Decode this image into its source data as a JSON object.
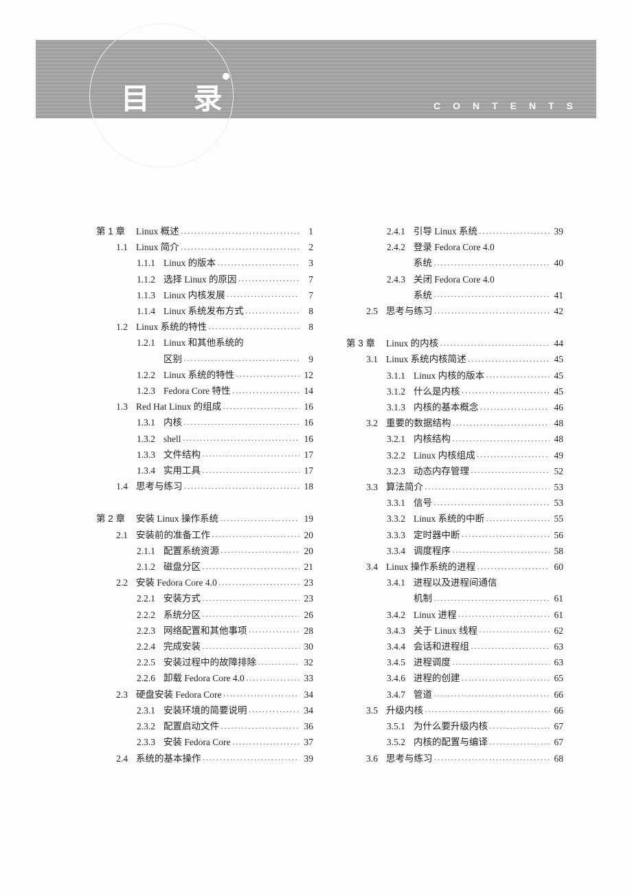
{
  "header": {
    "title_cn": "目 录",
    "title_en": "CONTENTS"
  },
  "columns": [
    [
      {
        "type": "chap",
        "num": "第 1 章",
        "label": "Linux 概述",
        "page": "1"
      },
      {
        "type": "sec",
        "num": "1.1",
        "label": "Linux 简介",
        "page": "2"
      },
      {
        "type": "sub",
        "num": "1.1.1",
        "label": "Linux 的版本",
        "page": "3"
      },
      {
        "type": "sub",
        "num": "1.1.2",
        "label": "选择 Linux 的原因",
        "page": "7"
      },
      {
        "type": "sub",
        "num": "1.1.3",
        "label": "Linux 内核发展",
        "page": "7"
      },
      {
        "type": "sub",
        "num": "1.1.4",
        "label": "Linux 系统发布方式",
        "page": "8"
      },
      {
        "type": "sec",
        "num": "1.2",
        "label": "Linux 系统的特性",
        "page": "8"
      },
      {
        "type": "sub",
        "num": "1.2.1",
        "label": "Linux 和其他系统的",
        "cont": true
      },
      {
        "type": "subcont",
        "label": "区别",
        "page": "9"
      },
      {
        "type": "sub",
        "num": "1.2.2",
        "label": "Linux 系统的特性",
        "page": "12"
      },
      {
        "type": "sub",
        "num": "1.2.3",
        "label": "Fedora Core 特性",
        "page": "14"
      },
      {
        "type": "sec",
        "num": "1.3",
        "label": "Red Hat Linux 的组成",
        "page": "16"
      },
      {
        "type": "sub",
        "num": "1.3.1",
        "label": "内核",
        "page": "16"
      },
      {
        "type": "sub",
        "num": "1.3.2",
        "label": "shell",
        "page": "16"
      },
      {
        "type": "sub",
        "num": "1.3.3",
        "label": "文件结构",
        "page": "17"
      },
      {
        "type": "sub",
        "num": "1.3.4",
        "label": "实用工具",
        "page": "17"
      },
      {
        "type": "sec",
        "num": "1.4",
        "label": "思考与练习",
        "page": "18"
      },
      {
        "type": "gap"
      },
      {
        "type": "chap",
        "num": "第 2 章",
        "label": "安装 Linux 操作系统",
        "page": "19"
      },
      {
        "type": "sec",
        "num": "2.1",
        "label": "安装前的准备工作",
        "page": "20"
      },
      {
        "type": "sub",
        "num": "2.1.1",
        "label": "配置系统资源",
        "page": "20"
      },
      {
        "type": "sub",
        "num": "2.1.2",
        "label": "磁盘分区",
        "page": "21"
      },
      {
        "type": "sec",
        "num": "2.2",
        "label": "安装 Fedora Core 4.0",
        "page": "23"
      },
      {
        "type": "sub",
        "num": "2.2.1",
        "label": "安装方式",
        "page": "23"
      },
      {
        "type": "sub",
        "num": "2.2.2",
        "label": "系统分区",
        "page": "26"
      },
      {
        "type": "sub",
        "num": "2.2.3",
        "label": "网络配置和其他事项",
        "page": "28"
      },
      {
        "type": "sub",
        "num": "2.2.4",
        "label": "完成安装",
        "page": "30"
      },
      {
        "type": "sub",
        "num": "2.2.5",
        "label": "安装过程中的故障排除",
        "page": "32"
      },
      {
        "type": "sub",
        "num": "2.2.6",
        "label": "卸载 Fedora Core 4.0",
        "page": "33"
      },
      {
        "type": "sec",
        "num": "2.3",
        "label": "硬盘安装 Fedora Core",
        "page": "34"
      },
      {
        "type": "sub",
        "num": "2.3.1",
        "label": "安装环境的简要说明",
        "page": "34"
      },
      {
        "type": "sub",
        "num": "2.3.2",
        "label": "配置启动文件",
        "page": "36"
      },
      {
        "type": "sub",
        "num": "2.3.3",
        "label": "安装 Fedora Core",
        "page": "37"
      },
      {
        "type": "sec",
        "num": "2.4",
        "label": "系统的基本操作",
        "page": "39"
      }
    ],
    [
      {
        "type": "sub",
        "num": "2.4.1",
        "label": "引导 Linux 系统",
        "page": "39"
      },
      {
        "type": "sub",
        "num": "2.4.2",
        "label": "登录 Fedora Core 4.0",
        "cont": true
      },
      {
        "type": "subcont",
        "label": "系统",
        "page": "40"
      },
      {
        "type": "sub",
        "num": "2.4.3",
        "label": "关闭 Fedora Core 4.0",
        "cont": true
      },
      {
        "type": "subcont",
        "label": "系统",
        "page": "41"
      },
      {
        "type": "sec",
        "num": "2.5",
        "label": "思考与练习",
        "page": "42"
      },
      {
        "type": "gap"
      },
      {
        "type": "chap",
        "num": "第 3 章",
        "label": "Linux 的内核",
        "page": "44"
      },
      {
        "type": "sec",
        "num": "3.1",
        "label": "Linux 系统内核简述",
        "page": "45"
      },
      {
        "type": "sub",
        "num": "3.1.1",
        "label": "Linux 内核的版本",
        "page": "45"
      },
      {
        "type": "sub",
        "num": "3.1.2",
        "label": "什么是内核",
        "page": "45"
      },
      {
        "type": "sub",
        "num": "3.1.3",
        "label": "内核的基本概念",
        "page": "46"
      },
      {
        "type": "sec",
        "num": "3.2",
        "label": "重要的数据结构",
        "page": "48"
      },
      {
        "type": "sub",
        "num": "3.2.1",
        "label": "内核结构",
        "page": "48"
      },
      {
        "type": "sub",
        "num": "3.2.2",
        "label": "Linux 内核组成",
        "page": "49"
      },
      {
        "type": "sub",
        "num": "3.2.3",
        "label": "动态内存管理",
        "page": "52"
      },
      {
        "type": "sec",
        "num": "3.3",
        "label": "算法简介",
        "page": "53"
      },
      {
        "type": "sub",
        "num": "3.3.1",
        "label": "信号",
        "page": "53"
      },
      {
        "type": "sub",
        "num": "3.3.2",
        "label": "Linux 系统的中断",
        "page": "55"
      },
      {
        "type": "sub",
        "num": "3.3.3",
        "label": "定时器中断",
        "page": "56"
      },
      {
        "type": "sub",
        "num": "3.3.4",
        "label": "调度程序",
        "page": "58"
      },
      {
        "type": "sec",
        "num": "3.4",
        "label": "Linux 操作系统的进程",
        "page": "60"
      },
      {
        "type": "sub",
        "num": "3.4.1",
        "label": "进程以及进程间通信",
        "cont": true
      },
      {
        "type": "subcont",
        "label": "机制",
        "page": "61"
      },
      {
        "type": "sub",
        "num": "3.4.2",
        "label": "Linux 进程",
        "page": "61"
      },
      {
        "type": "sub",
        "num": "3.4.3",
        "label": "关于 Linux 线程",
        "page": "62"
      },
      {
        "type": "sub",
        "num": "3.4.4",
        "label": "会话和进程组",
        "page": "63"
      },
      {
        "type": "sub",
        "num": "3.4.5",
        "label": "进程调度",
        "page": "63"
      },
      {
        "type": "sub",
        "num": "3.4.6",
        "label": "进程的创建",
        "page": "65"
      },
      {
        "type": "sub",
        "num": "3.4.7",
        "label": "管道",
        "page": "66"
      },
      {
        "type": "sec",
        "num": "3.5",
        "label": "升级内核",
        "page": "66"
      },
      {
        "type": "sub",
        "num": "3.5.1",
        "label": "为什么要升级内核",
        "page": "67"
      },
      {
        "type": "sub",
        "num": "3.5.2",
        "label": "内核的配置与编译",
        "page": "67"
      },
      {
        "type": "sec",
        "num": "3.6",
        "label": "思考与练习",
        "page": "68"
      }
    ]
  ]
}
